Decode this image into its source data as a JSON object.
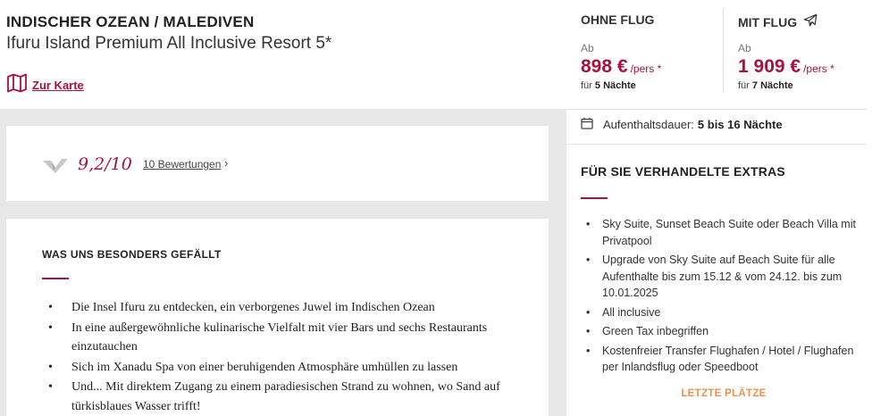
{
  "header": {
    "region": "INDISCHER OZEAN / MALEDIVEN",
    "hotel_name": "Ifuru Island Premium All Inclusive Resort 5*",
    "map_link": "Zur Karte"
  },
  "rating": {
    "score": "9,2/10",
    "reviews_link": "10 Bewertungen",
    "chevron": "›"
  },
  "likes": {
    "title": "WAS UNS BESONDERS GEFÄLLT",
    "items": [
      "Die Insel Ifuru zu entdecken, ein verborgenes Juwel im Indischen Ozean",
      "In eine außergewöhnliche kulinarische Vielfalt mit vier Bars und sechs Restaurants einzutauchen",
      "Sich im Xanadu Spa von einer beruhigenden Atmosphäre umhüllen zu lassen",
      "Und... Mit direktem Zugang zu einem paradiesischen Strand zu wohnen, wo Sand auf türkisblaues Wasser trifft!"
    ]
  },
  "pricing": {
    "without_flight": {
      "label": "OHNE FLUG",
      "from": "Ab",
      "price": "898 €",
      "per": "/pers *",
      "for_prefix": "für",
      "nights": "5 Nächte"
    },
    "with_flight": {
      "label": "MIT FLUG",
      "icon": "airplane-icon",
      "from": "Ab",
      "price": "1 909 €",
      "per": "/pers *",
      "for_prefix": "für",
      "nights": "7 Nächte"
    }
  },
  "stay": {
    "label": "Aufenthaltsdauer:",
    "value": "5 bis 16 Nächte",
    "icon": "calendar-icon"
  },
  "extras": {
    "title": "FÜR SIE VERHANDELTE EXTRAS",
    "items": [
      "Sky Suite, Sunset Beach Suite oder Beach Villa mit Privatpool",
      "Upgrade von Sky Suite auf Beach Suite für alle Aufenthalte bis zum 15.12 & vom 24.12. bis zum 10.01.2025",
      "All inclusive",
      "Green Tax inbegriffen",
      "Kostenfreier Transfer Flughafen / Hotel / Flughafen per Inlandsflug oder Speedboot"
    ],
    "badge": "LETZTE PLÄTZE"
  },
  "colors": {
    "accent": "#a8123e",
    "badge": "#f0924f",
    "panel_bg": "#e8e8e8"
  }
}
